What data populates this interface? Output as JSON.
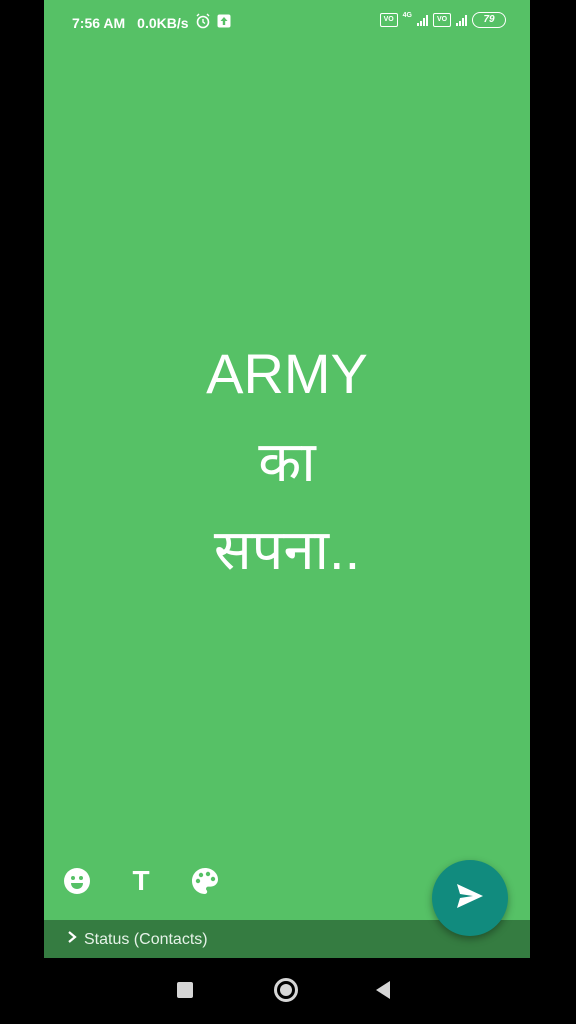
{
  "statusbar": {
    "time": "7:56 AM",
    "speed": "0.0KB/s",
    "battery": "79",
    "volte_badge": "VoLTE",
    "network_label": "4G",
    "icons": [
      "alarm-icon",
      "upload-icon",
      "volte-icon",
      "signal-icon",
      "battery-icon"
    ]
  },
  "status_text": {
    "line1": "ARMY",
    "line2": "का",
    "line3": "सपना.."
  },
  "toolbar": {
    "text_tool_label": "T",
    "icons": [
      "emoji-icon",
      "text-icon",
      "palette-icon"
    ]
  },
  "footer": {
    "audience": "Status (Contacts)",
    "send_icon": "send-icon"
  },
  "navbar": {
    "icons": [
      "recents-square-icon",
      "home-circle-icon",
      "back-triangle-icon"
    ]
  },
  "colors": {
    "background": "#56C166",
    "bottom_bar": "#357C41",
    "fab": "#118B7E"
  }
}
